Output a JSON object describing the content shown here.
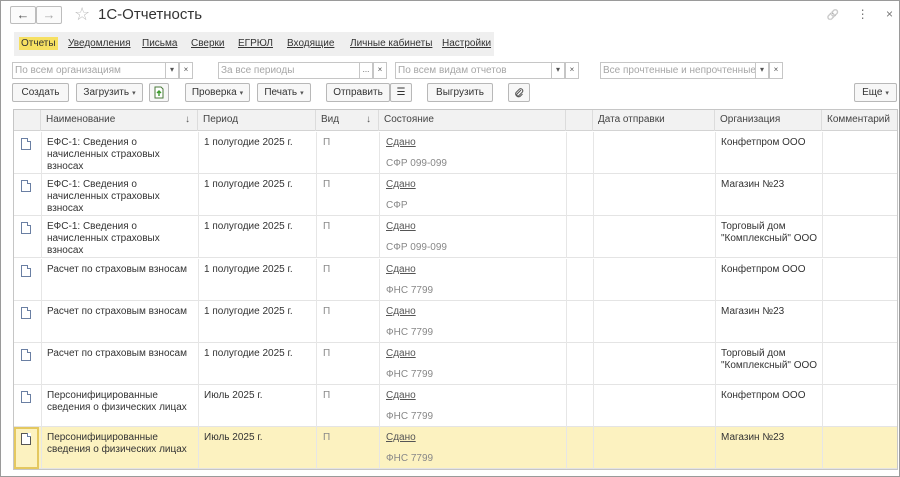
{
  "window": {
    "title": "1С-Отчетность",
    "nav_back": "←",
    "nav_forward": "→",
    "star": "☆",
    "link_icon": "🔗",
    "more_icon": "⋮",
    "close_icon": "×"
  },
  "menu": [
    {
      "label": "Отчеты",
      "active": true
    },
    {
      "label": "Уведомления"
    },
    {
      "label": "Письма"
    },
    {
      "label": "Сверки"
    },
    {
      "label": "ЕГРЮЛ"
    },
    {
      "label": "Входящие"
    },
    {
      "label": "Личные кабинеты"
    },
    {
      "label": "Настройки"
    }
  ],
  "filters": {
    "organization": "По всем организациям",
    "period": "За все периоды",
    "period_dots": "...",
    "report_type": "По всем видам отчетов",
    "read_state": "Все прочтенные и непрочтенные",
    "dropdown_glyph": "▾",
    "clear_glyph": "×"
  },
  "toolbar": {
    "create": "Создать",
    "load": "Загрузить",
    "check": "Проверка",
    "print": "Печать",
    "send": "Отправить",
    "export": "Выгрузить",
    "more": "Еще",
    "caret": "▾",
    "list_icon": "☰",
    "clip_icon": "⌁"
  },
  "table": {
    "columns": {
      "name": "Наименование",
      "period": "Период",
      "type": "Вид",
      "status": "Состояние",
      "send_date": "Дата отправки",
      "org": "Организация",
      "comment": "Комментарий",
      "sort_arrow": "↓"
    },
    "rows": [
      {
        "name": "ЕФС-1: Сведения о начисленных страховых взносах",
        "period": "1 полугодие 2025 г.",
        "type": "П",
        "status": "Сдано",
        "authority": "СФР 099-099",
        "org": "Конфетпром ООО",
        "send_date": "",
        "comment": ""
      },
      {
        "name": "ЕФС-1: Сведения о начисленных страховых взносах",
        "period": "1 полугодие 2025 г.",
        "type": "П",
        "status": "Сдано",
        "authority": "СФР",
        "org": "Магазин №23",
        "send_date": "",
        "comment": ""
      },
      {
        "name": "ЕФС-1: Сведения о начисленных страховых взносах",
        "period": "1 полугодие 2025 г.",
        "type": "П",
        "status": "Сдано",
        "authority": "СФР 099-099",
        "org": "Торговый дом \"Комплексный\" ООО",
        "send_date": "",
        "comment": ""
      },
      {
        "name": "Расчет по страховым взносам",
        "period": "1 полугодие 2025 г.",
        "type": "П",
        "status": "Сдано",
        "authority": "ФНС 7799",
        "org": "Конфетпром ООО",
        "send_date": "",
        "comment": ""
      },
      {
        "name": "Расчет по страховым взносам",
        "period": "1 полугодие 2025 г.",
        "type": "П",
        "status": "Сдано",
        "authority": "ФНС 7799",
        "org": "Магазин №23",
        "send_date": "",
        "comment": ""
      },
      {
        "name": "Расчет по страховым взносам",
        "period": "1 полугодие 2025 г.",
        "type": "П",
        "status": "Сдано",
        "authority": "ФНС 7799",
        "org": "Торговый дом \"Комплексный\" ООО",
        "send_date": "",
        "comment": ""
      },
      {
        "name": "Персонифицированные сведения о физических лицах",
        "period": "Июль 2025 г.",
        "type": "П",
        "status": "Сдано",
        "authority": "ФНС 7799",
        "org": "Конфетпром ООО",
        "send_date": "",
        "comment": ""
      },
      {
        "name": "Персонифицированные сведения о физических лицах",
        "period": "Июль 2025 г.",
        "type": "П",
        "status": "Сдано",
        "authority": "ФНС 7799",
        "org": "Магазин №23",
        "send_date": "",
        "comment": "",
        "selected": true
      }
    ]
  }
}
